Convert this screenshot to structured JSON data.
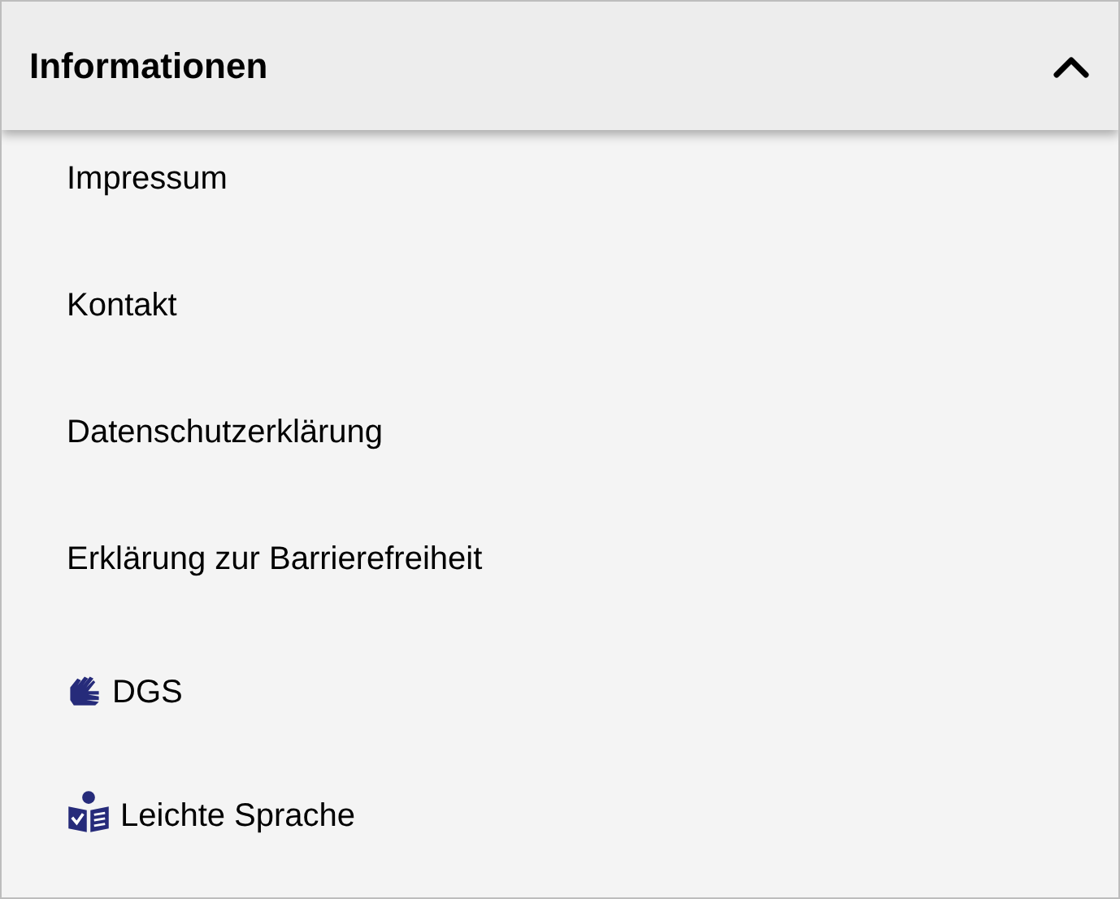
{
  "section": {
    "title": "Informationen",
    "expanded": true
  },
  "items": [
    {
      "label": "Impressum",
      "kind": "link"
    },
    {
      "label": "Kontakt",
      "kind": "link"
    },
    {
      "label": "Datenschutzerklärung",
      "kind": "link"
    },
    {
      "label": "Erklärung zur Barrierefreiheit",
      "kind": "link"
    },
    {
      "label": "DGS",
      "kind": "sign-language"
    },
    {
      "label": "Leichte Sprache",
      "kind": "easy-read"
    }
  ]
}
